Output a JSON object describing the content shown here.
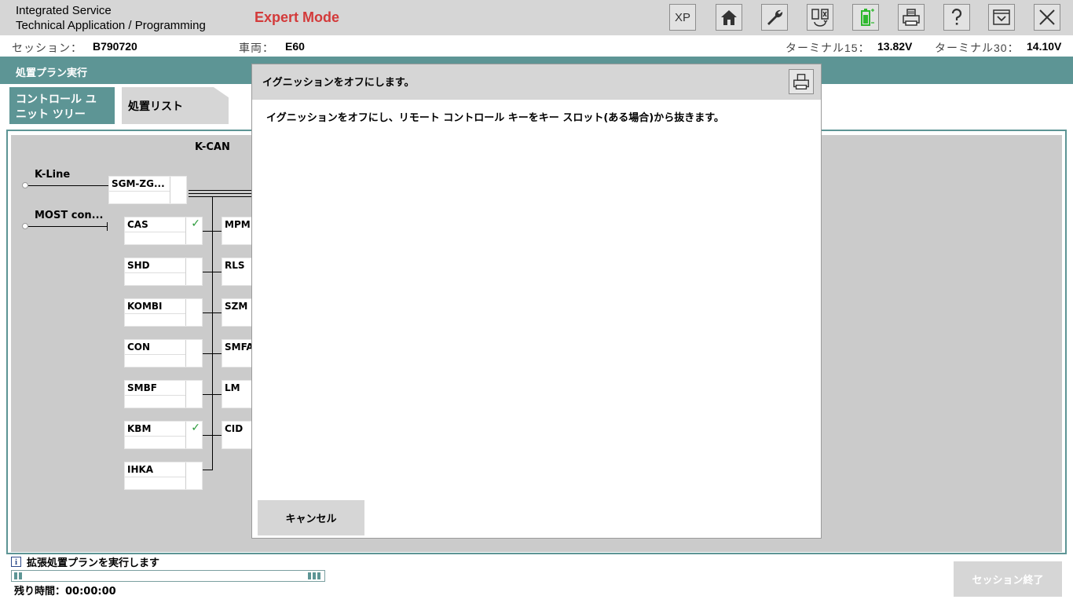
{
  "header": {
    "title_line1": "Integrated Service",
    "title_line2": "Technical Application / Programming",
    "mode": "Expert Mode",
    "xp_label": "XP",
    "icons": [
      "xp-icon",
      "home-icon",
      "wrench-icon",
      "transfer-icon",
      "battery-icon",
      "printer-icon",
      "help-icon",
      "dropdown-icon",
      "close-icon"
    ]
  },
  "session": {
    "session_label": "セッション：",
    "session_value": "B790720",
    "vehicle_label": "車両：",
    "vehicle_value": "E60",
    "terminal15_label": "ターミナル15：",
    "terminal15_value": "13.82V",
    "terminal30_label": "ターミナル30：",
    "terminal30_value": "14.10V"
  },
  "band": {
    "title": "処置プラン実行"
  },
  "tabs": {
    "control_unit_tree_line1": "コントロール ユ",
    "control_unit_tree_line2": "ニット ツリー",
    "action_list": "処置リスト"
  },
  "tree": {
    "bus_main": "K-CAN",
    "bus_kline": "K-Line",
    "bus_most": "MOST con...",
    "gateway": "SGM-ZG...",
    "left_column": [
      {
        "name": "CAS",
        "checked": true
      },
      {
        "name": "SHD",
        "checked": false
      },
      {
        "name": "KOMBI",
        "checked": false
      },
      {
        "name": "CON",
        "checked": false
      },
      {
        "name": "SMBF",
        "checked": false
      },
      {
        "name": "KBM",
        "checked": true
      },
      {
        "name": "IHKA",
        "checked": false
      }
    ],
    "right_column": [
      "MPM",
      "RLS",
      "SZM",
      "SMFA",
      "LM",
      "CID"
    ],
    "check_mark": "✓"
  },
  "modal": {
    "title": "イグニッションをオフにします。",
    "message": "イグニッションをオフにし、リモート コントロール キーをキー スロット(ある場合)から抜きます。",
    "cancel_label": "キャンセル"
  },
  "footer": {
    "info_icon_glyph": "i",
    "info_text": "拡張処置プランを実行します",
    "remaining": "残り時間：00:00:00",
    "end_session_label": "セッション終了"
  },
  "colors": {
    "accent": "#5d9595",
    "expert_mode": "#d33a3a",
    "check": "#2a9a3a",
    "battery": "#2eb82e"
  }
}
